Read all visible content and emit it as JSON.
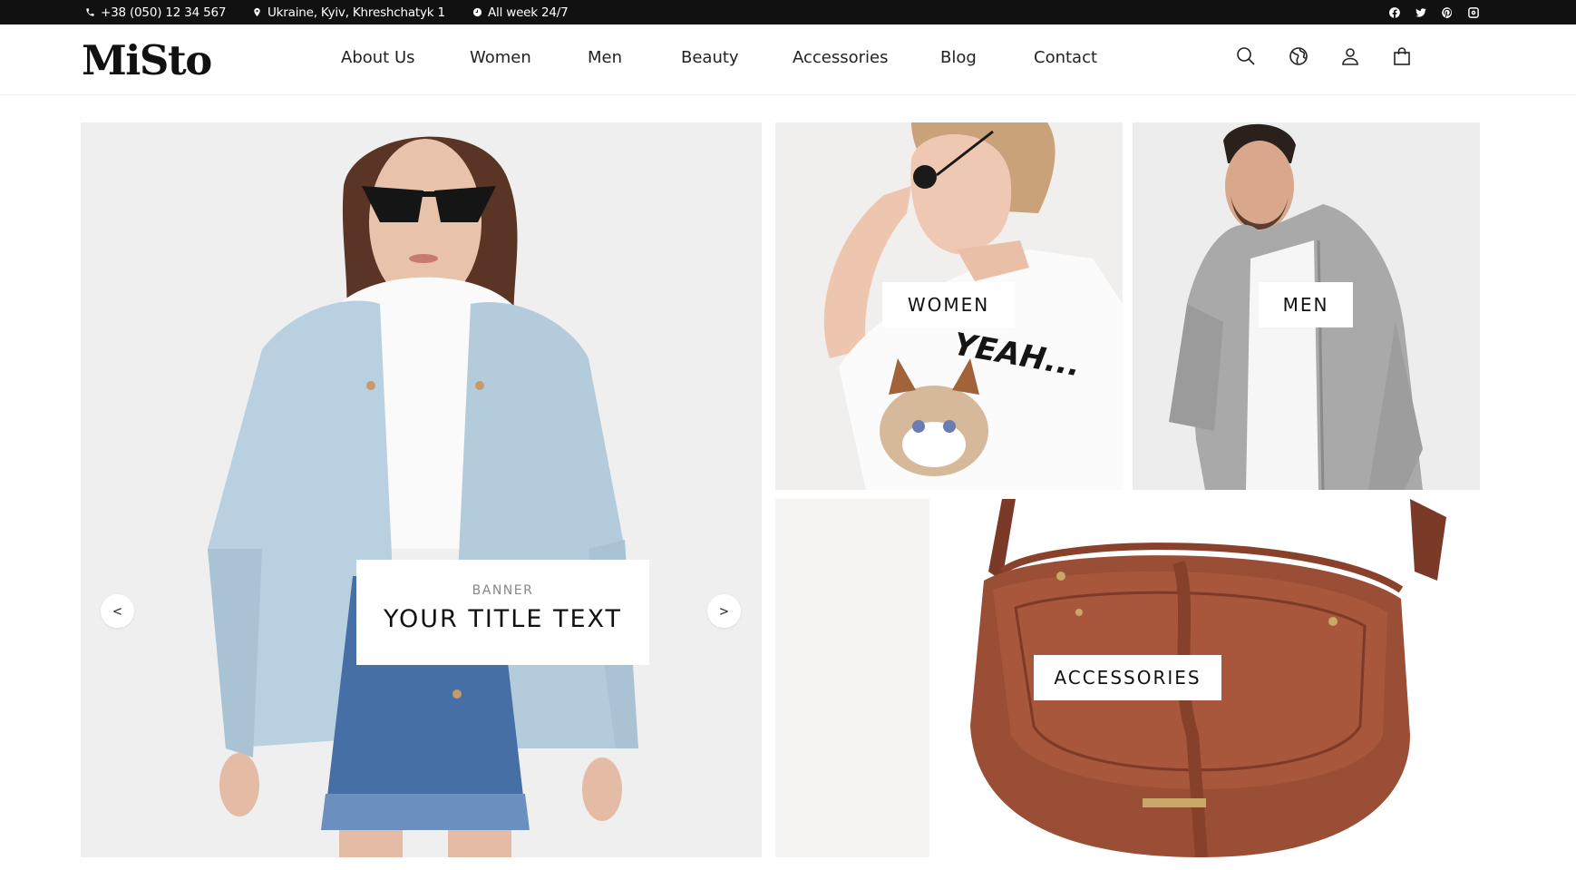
{
  "topbar": {
    "phone": "+38 (050) 12 34 567",
    "address": "Ukraine, Kyiv, Khreshchatyk 1",
    "hours": "All week 24/7",
    "social_icons": [
      "facebook-icon",
      "twitter-icon",
      "pinterest-icon",
      "instagram-icon"
    ]
  },
  "header": {
    "logo": "MiSto",
    "nav": [
      "About Us",
      "Women",
      "Men",
      "Beauty",
      "Accessories",
      "Blog",
      "Contact"
    ],
    "icons": [
      "search-icon",
      "globe-icon",
      "user-icon",
      "cart-icon"
    ]
  },
  "hero": {
    "eyebrow": "BANNER",
    "title": "YOUR TITLE TEXT",
    "prev": "<",
    "next": ">"
  },
  "categories": {
    "women": "WOMEN",
    "men": "MEN",
    "accessories": "ACCESSORIES"
  },
  "colors": {
    "topbar_bg": "#111111",
    "text": "#111111",
    "denim_light": "#b9d0e0",
    "bag_brown": "#9a4e36"
  }
}
